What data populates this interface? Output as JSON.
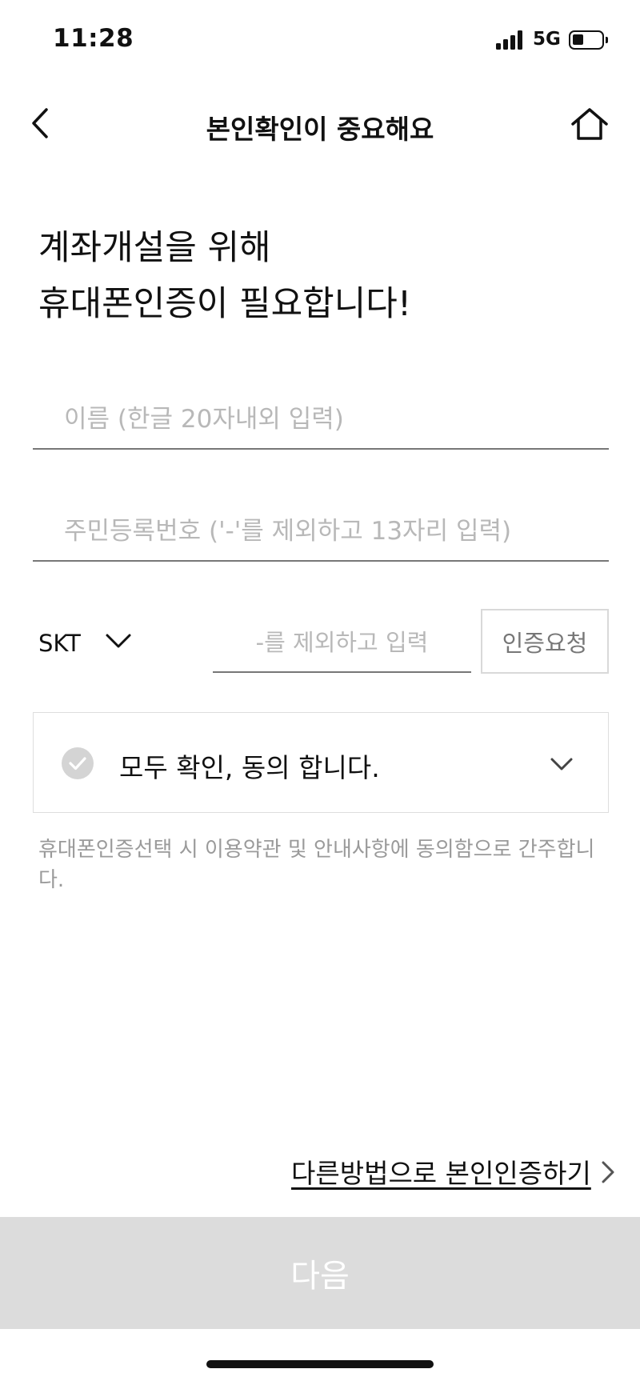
{
  "status_bar": {
    "time": "11:28",
    "network": "5G",
    "signal_icon": "signal-bars-icon",
    "battery_icon": "battery-icon"
  },
  "nav": {
    "title": "본인확인이 중요해요",
    "back_icon": "chevron-left-icon",
    "home_icon": "home-icon"
  },
  "heading": {
    "line1": "계좌개설을 위해",
    "line2": "휴대폰인증이 필요합니다!"
  },
  "form": {
    "name_placeholder": "이름 (한글 20자내외 입력)",
    "name_value": "",
    "rrn_placeholder": "주민등록번호 ('-'를 제외하고 13자리 입력)",
    "rrn_value": "",
    "carrier": "SKT",
    "phone_placeholder": "-를 제외하고 입력",
    "phone_value": "",
    "request_label": "인증요청"
  },
  "agree": {
    "label": "모두 확인, 동의 합니다.",
    "checked": false
  },
  "consent_note": "휴대폰인증선택 시 이용약관 및 안내사항에 동의함으로 간주합니다.",
  "alt_link": "다른방법으로 본인인증하기",
  "next_label": "다음",
  "colors": {
    "next_button_bg": "#dcdcdc",
    "placeholder": "#b8b8b8",
    "check_icon": "#d4d4d4"
  }
}
